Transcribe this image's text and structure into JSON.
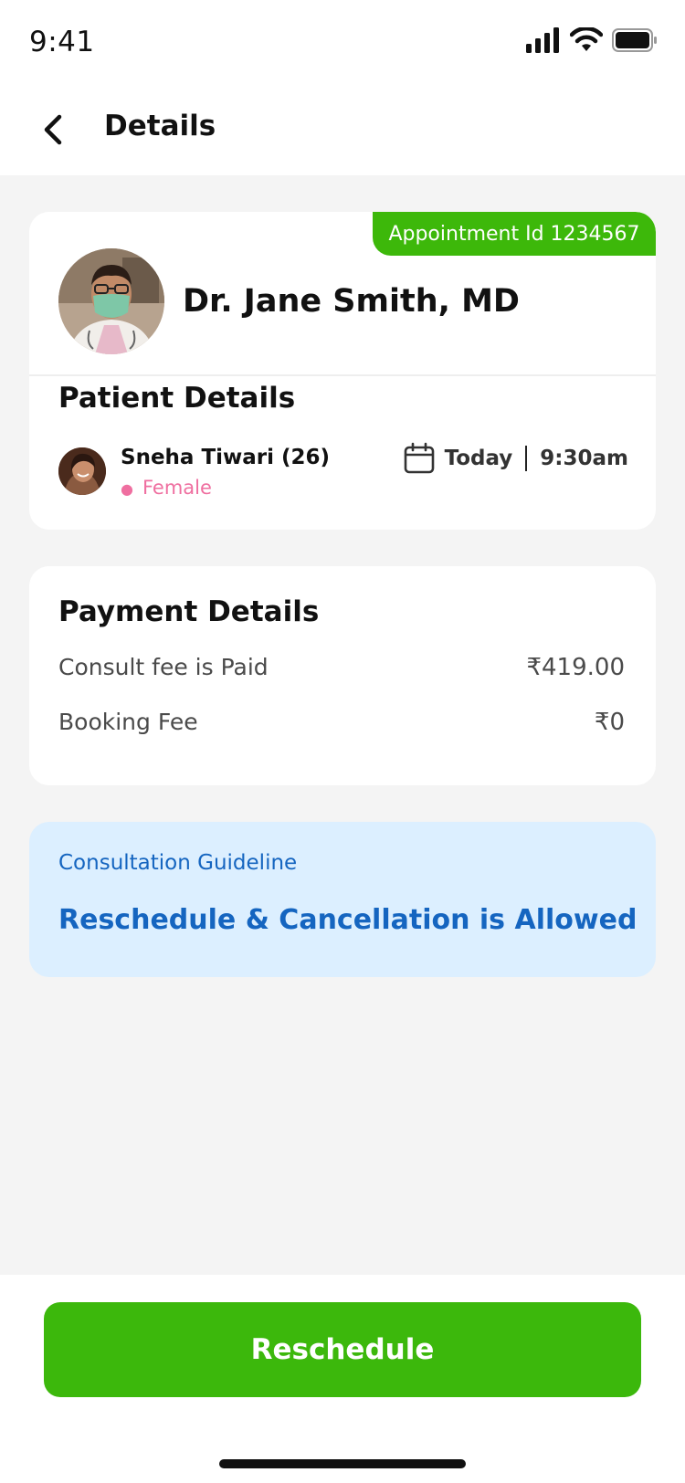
{
  "status_bar": {
    "time": "9:41",
    "icons": [
      "signal-icon",
      "wifi-icon",
      "battery-icon"
    ]
  },
  "header": {
    "title": "Details",
    "back_icon": "chevron-left-icon"
  },
  "doctor_card": {
    "appointment_badge": "Appointment Id 1234567",
    "doctor_name": "Dr. Jane Smith, MD",
    "patient_section_title": "Patient Details",
    "patient": {
      "name": "Sneha Tiwari (26)",
      "gender": "Female"
    },
    "appointment": {
      "day": "Today",
      "time": "9:30am",
      "icon": "calendar-icon"
    }
  },
  "payment_card": {
    "title": "Payment Details",
    "rows": [
      {
        "label": "Consult fee is Paid",
        "amount": "₹419.00"
      },
      {
        "label": "Booking Fee",
        "amount": "₹0"
      }
    ]
  },
  "guideline_card": {
    "label": "Consultation Guideline",
    "text": "Reschedule & Cancellation is Allowed"
  },
  "footer": {
    "button_label": "Reschedule"
  },
  "colors": {
    "accent_green": "#3cb80c",
    "guideline_bg": "#dcefff",
    "guideline_text": "#1565c0",
    "gender_pink": "#ef6fa0"
  }
}
